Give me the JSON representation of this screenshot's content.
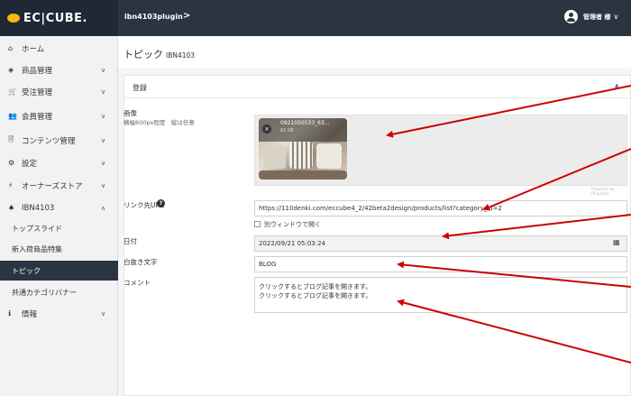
{
  "header": {
    "logo": "EC|CUBE.",
    "shop_name": "ibn4103plugin",
    "shop_chevron": ">",
    "user_name": "管理者 様",
    "user_chevron": "∨"
  },
  "sidebar": {
    "items": [
      {
        "icon": "⌂",
        "label": "ホーム",
        "chevron": ""
      },
      {
        "icon": "◈",
        "label": "商品管理",
        "chevron": "∨"
      },
      {
        "icon": "🛒",
        "label": "受注管理",
        "chevron": "∨"
      },
      {
        "icon": "👥",
        "label": "会員管理",
        "chevron": "∨"
      },
      {
        "icon": "🗎",
        "label": "コンテンツ管理",
        "chevron": "∨"
      },
      {
        "icon": "⚙",
        "label": "設定",
        "chevron": "∨"
      },
      {
        "icon": "⚡",
        "label": "オーナーズストア",
        "chevron": "∨"
      },
      {
        "icon": "♠",
        "label": "IBN4103",
        "chevron": "∧"
      }
    ],
    "subitems": [
      {
        "label": "トップスライド"
      },
      {
        "label": "新入荷商品特集"
      },
      {
        "label": "トピック"
      },
      {
        "label": "共通カテゴリバナー"
      }
    ],
    "info": {
      "icon": "ℹ",
      "label": "情報",
      "chevron": "∨"
    }
  },
  "page": {
    "title": "トピック",
    "subtitle": "IBN4103"
  },
  "card": {
    "title": "登録",
    "caret": "∧"
  },
  "form": {
    "image_label": "画像",
    "image_note": "横幅600px程度　縦は任意",
    "thumb_name": "0921050533_63...",
    "thumb_size": "82 KB",
    "powered": "Powered by Plupload",
    "link_label": "リンク先URL",
    "help": "?",
    "link_value": "https://110denki.com/eccube4_2/42beta2design/products/list?category_id=2",
    "new_window_label": "別ウィンドウで開く",
    "date_label": "日付",
    "date_value": "2022/09/21 05:03:24",
    "calendar_icon": "▦",
    "badge_label": "白抜き文字",
    "badge_value": "BLOG",
    "comment_label": "コメント",
    "comment_line1": "クリックするとブログ記事を開きます。",
    "comment_line2": "クリックするとブログ記事を開きます。"
  },
  "colors": {
    "header_bg": "#2b3541",
    "logo_bg": "#1f2834",
    "sidebar_bg": "#f2f2f2",
    "active_bg": "#2b3541",
    "arrow": "#cc0000"
  }
}
